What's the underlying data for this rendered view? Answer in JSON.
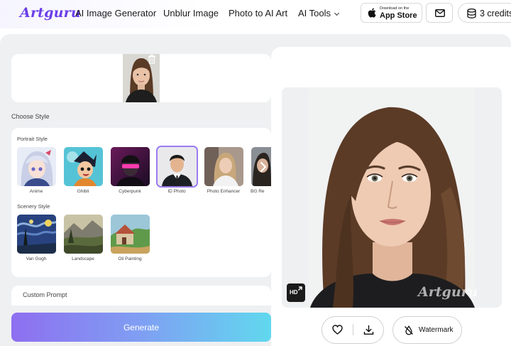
{
  "header": {
    "logo": "Artguru",
    "nav": [
      {
        "label": "AI Image Generator"
      },
      {
        "label": "Unblur Image"
      },
      {
        "label": "Photo to AI Art"
      },
      {
        "label": "AI Tools"
      }
    ],
    "appstore_small": "Download on the",
    "appstore_big": "App Store",
    "credits": "3 credits"
  },
  "upload": {
    "delete_icon": "trash-icon"
  },
  "choose_style_label": "Choose Style",
  "portrait": {
    "label": "Portrait Style",
    "styles": [
      "Anime",
      "Ghibli",
      "Cyberpunk",
      "ID Photo",
      "Photo Enhancer",
      "BG Re"
    ],
    "selected": "ID Photo"
  },
  "scenery": {
    "label": "Scenery Style",
    "styles": [
      "Van Gogh",
      "Landscape",
      "Oil Painting"
    ]
  },
  "prompt": {
    "label": "Custom Prompt"
  },
  "generate_label": "Generate",
  "preview": {
    "watermark_text": "Artguru",
    "hd_label": "HD"
  },
  "actions": {
    "watermark_label": "Watermark"
  },
  "colors": {
    "brand": "#6a3ee8",
    "selected_outline": "#9a7bf0"
  }
}
